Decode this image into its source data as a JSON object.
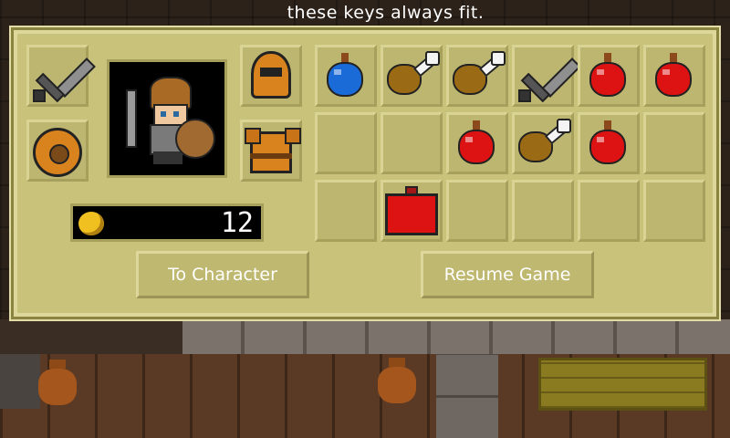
{
  "hint_text": "these keys always fit.",
  "inventory": {
    "gold_amount": "12",
    "equipment": [
      {
        "slot": "weapon",
        "icon": "sword-icon"
      },
      {
        "slot": "head",
        "icon": "helmet-icon"
      },
      {
        "slot": "offhand",
        "icon": "shield-icon"
      },
      {
        "slot": "body",
        "icon": "armor-icon"
      }
    ],
    "backpack": [
      [
        "blue-potion-icon",
        "meat-icon",
        "meat-icon",
        "sword-icon",
        "red-potion-icon",
        "red-potion-icon"
      ],
      [
        "",
        "",
        "red-potion-icon",
        "meat-icon",
        "red-potion-icon",
        ""
      ],
      [
        "",
        "red-potion-large-icon",
        "",
        "",
        "",
        ""
      ]
    ]
  },
  "buttons": {
    "to_character": "To Character",
    "resume_game": "Resume Game"
  },
  "colors": {
    "panel": "#c9c27a",
    "potion_blue": "#1a6ad8",
    "potion_red": "#dd1212",
    "orange_gear": "#d8831e"
  }
}
